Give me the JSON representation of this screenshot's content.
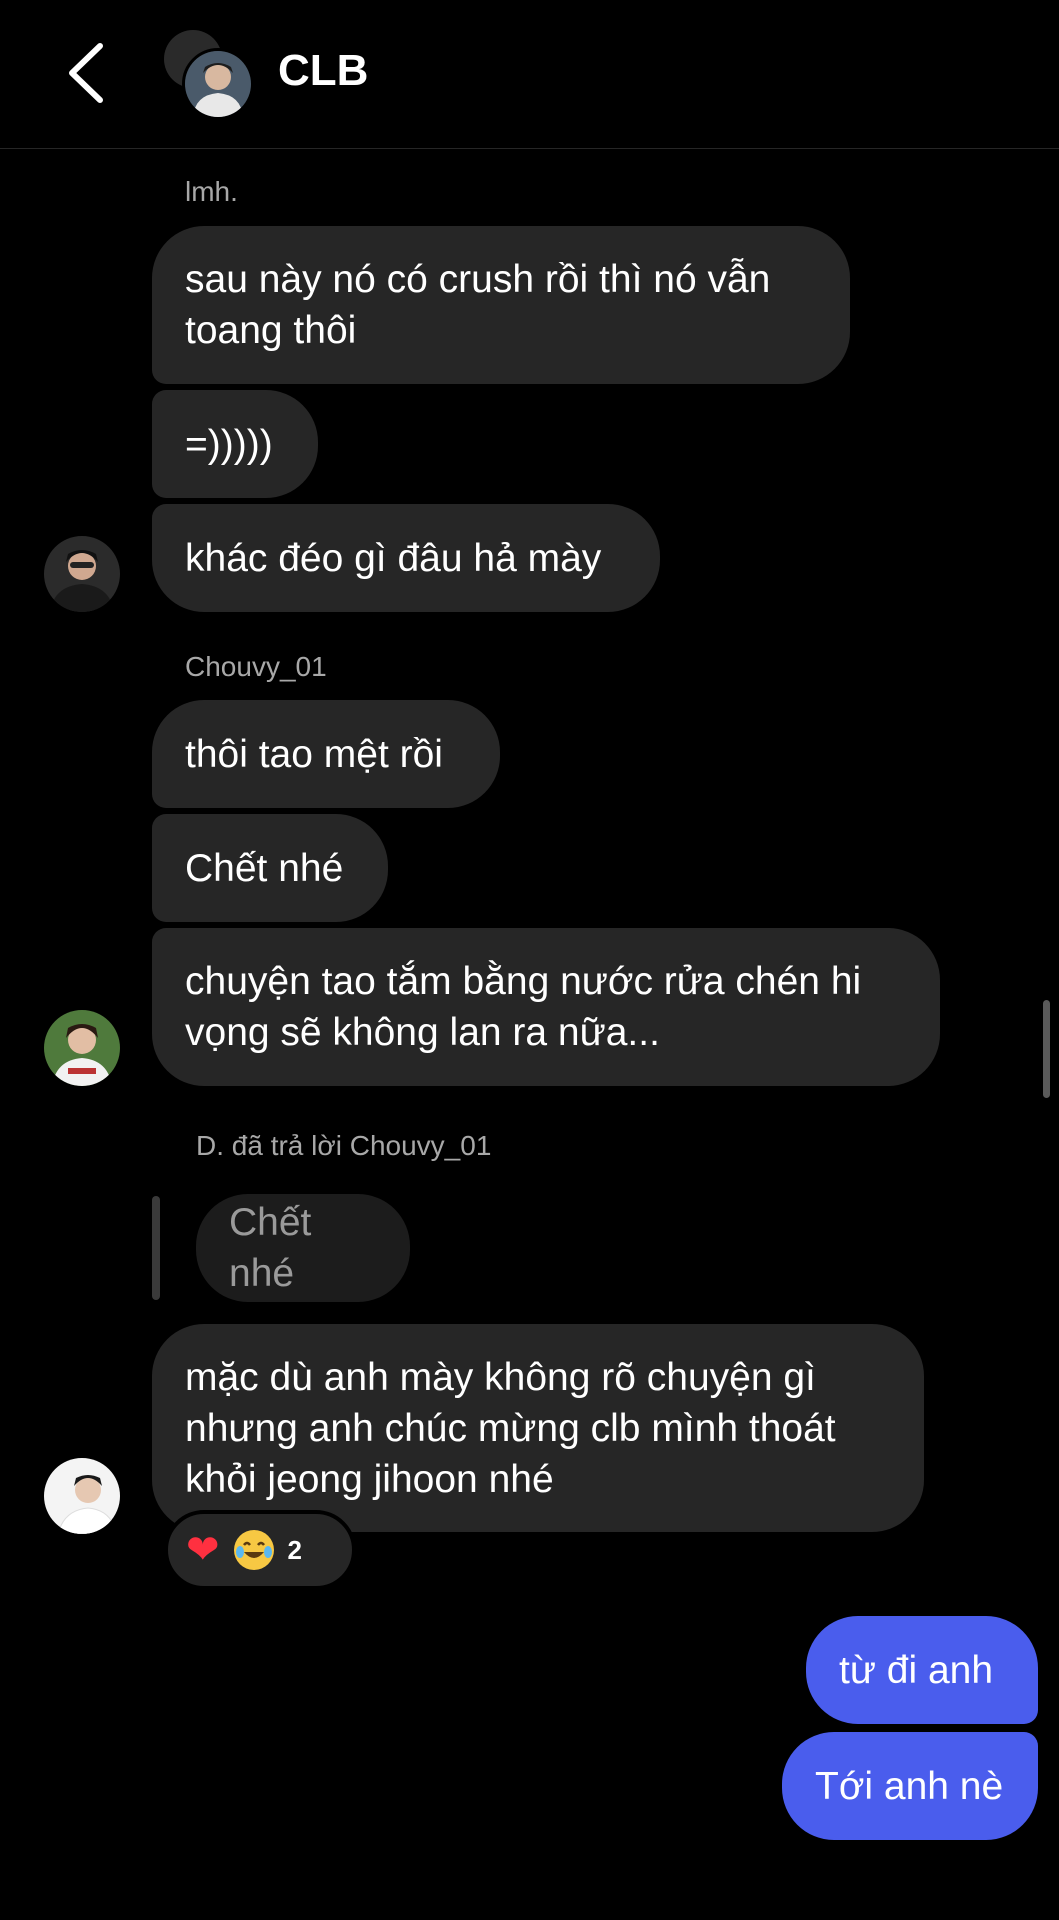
{
  "header": {
    "title": "CLB",
    "back_icon": "chevron-left-icon"
  },
  "messages": [
    {
      "sender": "lmh.",
      "texts": [
        "sau này nó có crush rồi thì nó vẫn\ntoang thôi",
        "=)))))",
        "khác đéo gì đâu hả mày"
      ]
    },
    {
      "sender": "Chouvy_01",
      "texts": [
        "thôi tao mệt rồi",
        "Chết nhé",
        "chuyện tao tắm bằng nước rửa chén hi\nvọng sẽ không lan ra nữa..."
      ]
    },
    {
      "reply_label": "D. đã trả lời Chouvy_01",
      "quoted": "Chết nhé",
      "text": "mặc dù anh mày không rõ chuyện gì\nnhưng anh chúc mừng clb mình thoát\nkhỏi jeong jihoon nhé",
      "reactions": {
        "icons": [
          "heart-icon",
          "laughing-tears-icon"
        ],
        "count": "2"
      }
    }
  ],
  "my_messages": [
    "từ đi anh",
    "Tới anh nè"
  ],
  "colors": {
    "background": "#000000",
    "bubble_other": "#262626",
    "bubble_self": "#4a5ded",
    "secondary_text": "#a8a8a8",
    "heart": "#ff3040"
  }
}
